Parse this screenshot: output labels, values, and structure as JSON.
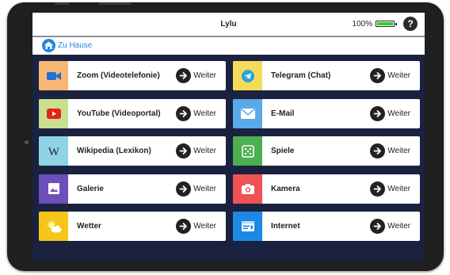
{
  "header": {
    "title": "Lylu",
    "battery_percent": "100%",
    "battery_level": 1.0,
    "help_label": "?"
  },
  "breadcrumb": {
    "label": "Zu Hause"
  },
  "go_label": "Weiter",
  "colors": {
    "screen_bg": "#1a2240",
    "accent": "#1e88e5",
    "battery": "#2bd02b"
  },
  "tiles": [
    {
      "label": "Zoom (Videotelefonie)",
      "icon": "zoom-icon",
      "color": "#f7b876"
    },
    {
      "label": "Telegram (Chat)",
      "icon": "telegram-icon",
      "color": "#f4dc5a"
    },
    {
      "label": "YouTube (Videoportal)",
      "icon": "youtube-icon",
      "color": "#c8df8f"
    },
    {
      "label": "E-Mail",
      "icon": "email-icon",
      "color": "#5aa9e8"
    },
    {
      "label": "Wikipedia (Lexikon)",
      "icon": "wikipedia-icon",
      "color": "#8fd3e6"
    },
    {
      "label": "Spiele",
      "icon": "games-icon",
      "color": "#4caf50"
    },
    {
      "label": "Galerie",
      "icon": "gallery-icon",
      "color": "#6c4fb8"
    },
    {
      "label": "Kamera",
      "icon": "camera-icon",
      "color": "#ef5353"
    },
    {
      "label": "Wetter",
      "icon": "weather-icon",
      "color": "#f6c51a"
    },
    {
      "label": "Internet",
      "icon": "internet-icon",
      "color": "#1e88e5"
    }
  ]
}
